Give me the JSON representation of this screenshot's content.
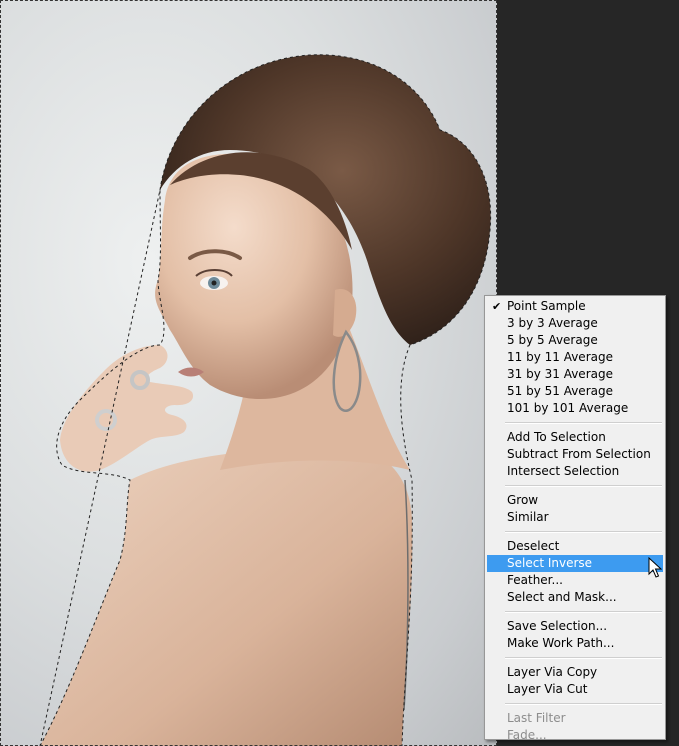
{
  "context_menu": {
    "groups": [
      {
        "items": [
          {
            "label": "Point Sample",
            "checked": true
          },
          {
            "label": "3 by 3 Average"
          },
          {
            "label": "5 by 5 Average"
          },
          {
            "label": "11 by 11 Average"
          },
          {
            "label": "31 by 31 Average"
          },
          {
            "label": "51 by 51 Average"
          },
          {
            "label": "101 by 101 Average"
          }
        ]
      },
      {
        "items": [
          {
            "label": "Add To Selection"
          },
          {
            "label": "Subtract From Selection"
          },
          {
            "label": "Intersect Selection"
          }
        ]
      },
      {
        "items": [
          {
            "label": "Grow"
          },
          {
            "label": "Similar"
          }
        ]
      },
      {
        "items": [
          {
            "label": "Deselect"
          },
          {
            "label": "Select Inverse",
            "highlighted": true
          },
          {
            "label": "Feather..."
          },
          {
            "label": "Select and Mask..."
          }
        ]
      },
      {
        "items": [
          {
            "label": "Save Selection..."
          },
          {
            "label": "Make Work Path..."
          }
        ]
      },
      {
        "items": [
          {
            "label": "Layer Via Copy"
          },
          {
            "label": "Layer Via Cut"
          }
        ]
      },
      {
        "items": [
          {
            "label": "Last Filter",
            "disabled": true
          },
          {
            "label": "Fade...",
            "disabled": true
          }
        ]
      }
    ]
  },
  "colors": {
    "workspace_bg": "#262626",
    "menu_bg": "#f0f0f0",
    "menu_highlight": "#3d9bf0",
    "disabled_text": "#8d8d8d"
  },
  "icons": {
    "check": "check-icon",
    "cursor": "arrow-cursor-icon"
  }
}
